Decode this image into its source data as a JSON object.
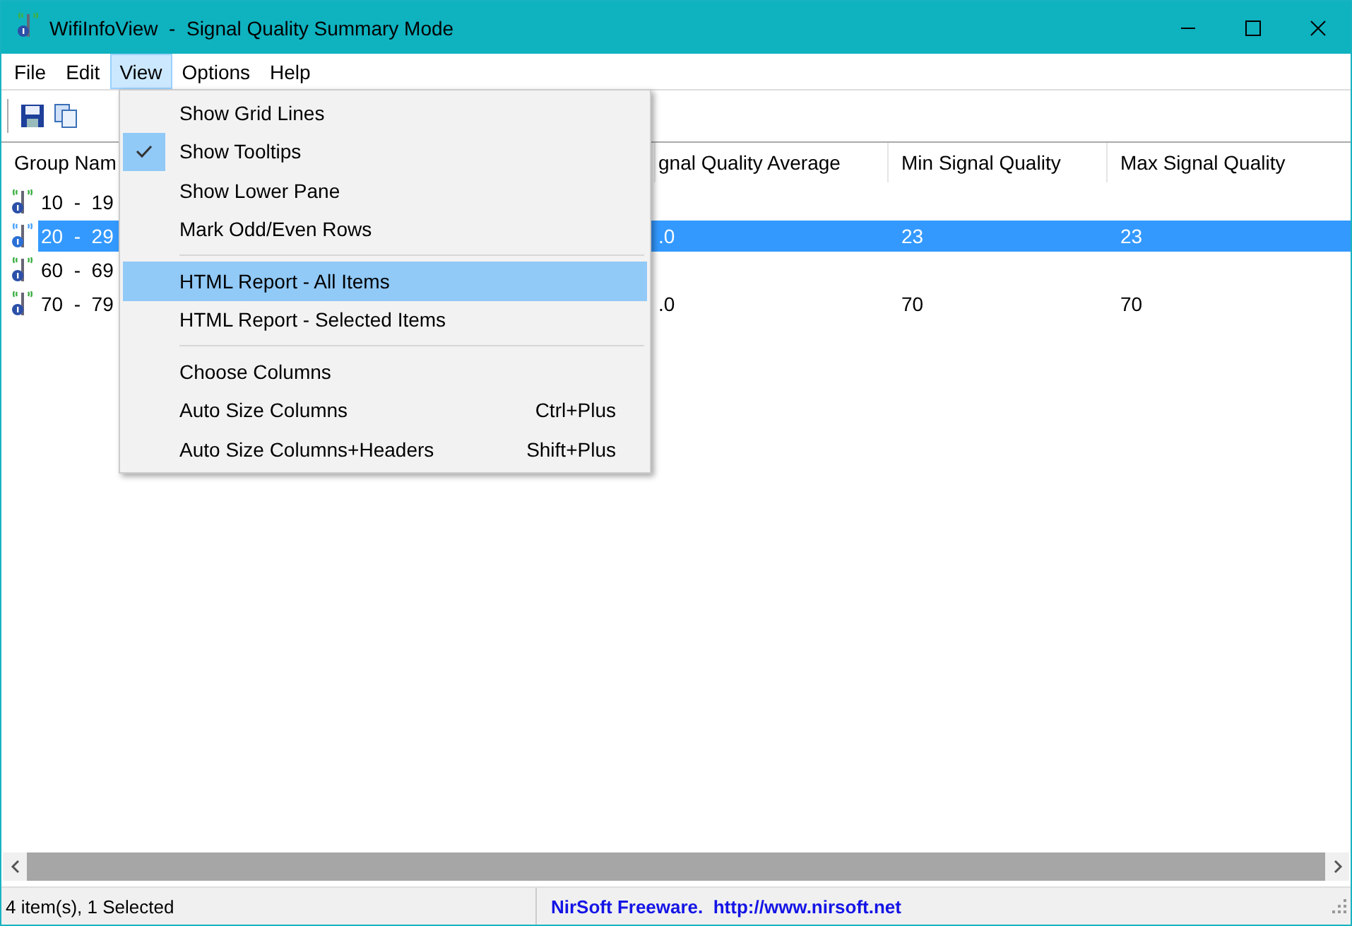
{
  "window": {
    "title": "WifiInfoView  -  Signal Quality Summary Mode"
  },
  "menu_bar": [
    {
      "label": "File",
      "selected": false
    },
    {
      "label": "Edit",
      "selected": false
    },
    {
      "label": "View",
      "selected": true
    },
    {
      "label": "Options",
      "selected": false
    },
    {
      "label": "Help",
      "selected": false
    }
  ],
  "view_menu": [
    {
      "kind": "item",
      "label": "Show Grid Lines",
      "checked": false,
      "selected": false
    },
    {
      "kind": "item",
      "label": "Show Tooltips",
      "checked": true,
      "selected": false
    },
    {
      "kind": "item",
      "label": "Show Lower Pane",
      "checked": false,
      "selected": false
    },
    {
      "kind": "item",
      "label": "Mark Odd/Even Rows",
      "checked": false,
      "selected": false
    },
    {
      "kind": "separator"
    },
    {
      "kind": "item",
      "label": "HTML Report - All Items",
      "checked": false,
      "selected": true
    },
    {
      "kind": "item",
      "label": "HTML Report - Selected Items",
      "checked": false,
      "selected": false
    },
    {
      "kind": "separator"
    },
    {
      "kind": "item",
      "label": "Choose Columns",
      "checked": false,
      "selected": false
    },
    {
      "kind": "item",
      "label": "Auto Size Columns",
      "shortcut": "Ctrl+Plus",
      "checked": false,
      "selected": false
    },
    {
      "kind": "item",
      "label": "Auto Size Columns+Headers",
      "shortcut": "Shift+Plus",
      "checked": false,
      "selected": false
    }
  ],
  "table": {
    "columns": [
      "Group Nam",
      "gnal Quality Average",
      "Min Signal Quality",
      "Max Signal Quality"
    ],
    "rows": [
      {
        "cells": [
          "10  -  19",
          "",
          "",
          ""
        ],
        "selected": false
      },
      {
        "cells": [
          "20  -  29",
          ".0",
          "23",
          "23"
        ],
        "selected": true
      },
      {
        "cells": [
          "60  -  69",
          "",
          "",
          ""
        ],
        "selected": false
      },
      {
        "cells": [
          "70  -  79",
          ".0",
          "70",
          "70"
        ],
        "selected": false
      }
    ]
  },
  "status_bar": {
    "count": "4 item(s), 1 Selected",
    "credit": "NirSoft Freeware.  http://www.nirsoft.net"
  }
}
